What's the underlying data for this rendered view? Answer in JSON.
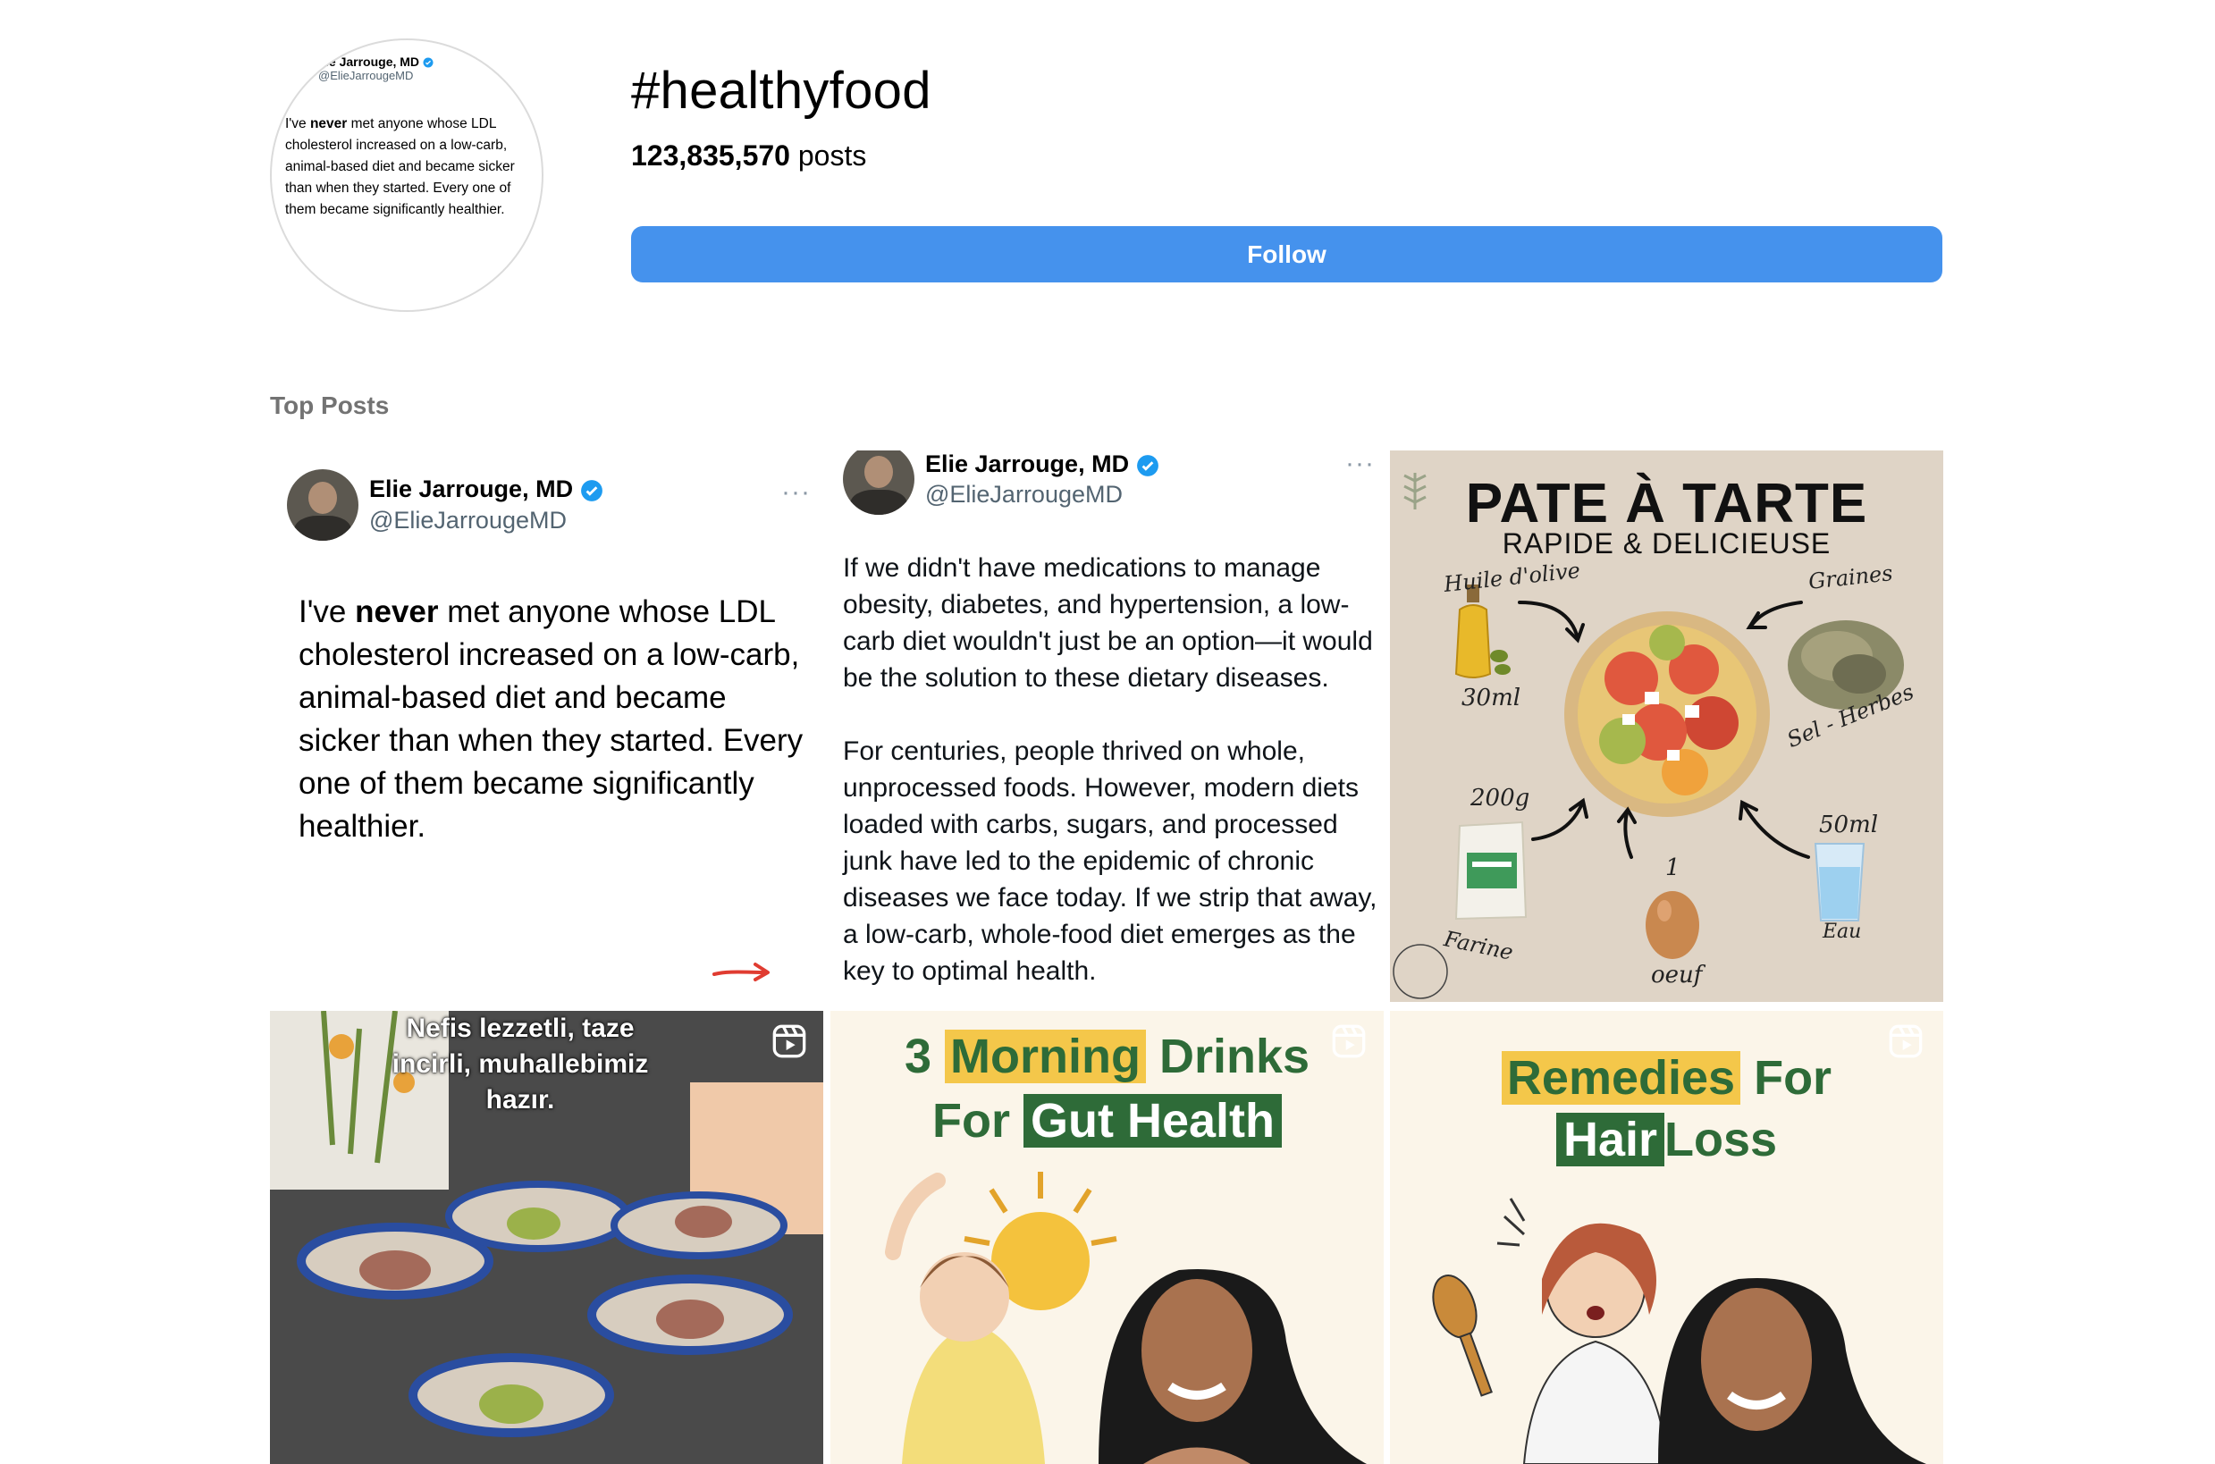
{
  "header": {
    "hashtag": "#healthyfood",
    "post_count": "123,835,570",
    "post_count_suffix": "posts",
    "follow_label": "Follow",
    "avatar_preview": {
      "name": "ie Jarrouge, MD",
      "handle": "@ElieJarrougeMD",
      "text_before": "I've ",
      "text_bold": "never",
      "text_after": " met anyone whose LDL cholesterol increased on a low-carb, animal-based diet and became sicker than when they started. Every one of them became significantly healthier."
    }
  },
  "section": {
    "label": "Top Posts"
  },
  "posts": [
    {
      "type": "tweet",
      "name": "Elie Jarrouge, MD",
      "handle": "@ElieJarrougeMD",
      "more": "···",
      "text_before": "I've ",
      "text_bold": "never",
      "text_after": " met anyone whose LDL cholesterol increased on a low-carb, animal-based diet and became sicker than when they started. Every one of them became significantly healthier."
    },
    {
      "type": "tweet",
      "name": "Elie Jarrouge, MD",
      "handle": "@ElieJarrougeMD",
      "more": "···",
      "paragraph_1": "If we didn't have medications to manage obesity, diabetes, and hypertension, a low-carb diet wouldn't just be an option—it would be the solution to these dietary diseases.",
      "paragraph_2": "For centuries, people thrived on whole, unprocessed foods. However, modern diets loaded with carbs, sugars, and processed junk have led to the epidemic of chronic diseases we face today. If we strip that away, a low-carb, whole-food diet emerges as the key to optimal health."
    },
    {
      "type": "recipe",
      "title": "PATE À TARTE",
      "subtitle": "RAPIDE & DELICIEUSE",
      "labels": {
        "oil": "Huile d'olive",
        "oil_qty": "30ml",
        "seeds": "Graines",
        "seeds_sub": "Sel - Herbes",
        "flour_qty": "200g",
        "flour": "Farine",
        "egg_qty": "1",
        "egg": "oeuf",
        "water_qty": "50ml",
        "water": "Eau"
      }
    },
    {
      "type": "reel",
      "caption": "Nefis lezzetli, taze incirli, muhallebimiz hazır."
    },
    {
      "type": "reel",
      "line1_a": "3",
      "line1_b": "Morning",
      "line1_c": "Drinks",
      "line2_a": "For",
      "line2_b": "Gut Health"
    },
    {
      "type": "reel",
      "line1_a": "Remedies",
      "line1_b": "For",
      "line2_a": "Hair",
      "line2_b": "Loss"
    }
  ],
  "colors": {
    "follow_bg": "#4592ed",
    "verified": "#1d9bf0",
    "promo_green": "#2e6b38",
    "promo_yellow": "#f4c74a",
    "section_label": "#737373"
  },
  "icons": [
    "verified-badge-icon",
    "more-options-icon",
    "reel-icon",
    "red-arrow-icon",
    "leaf-logo-icon"
  ]
}
